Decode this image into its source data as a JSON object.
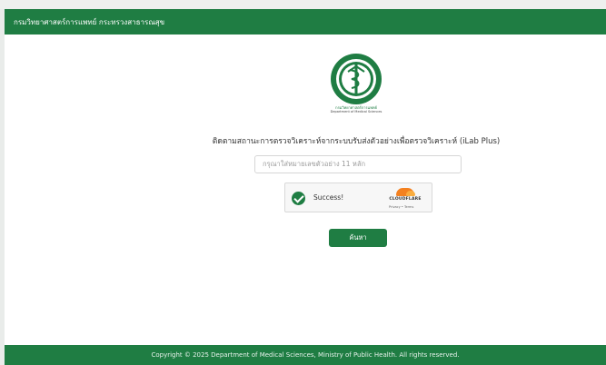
{
  "header": {
    "title": "กรมวิทยาศาสตร์การแพทย์ กระทรวงสาธารณสุข"
  },
  "logo": {
    "icon": "department-seal",
    "caption_thai": "กรมวิทยาศาสตร์การแพทย์",
    "caption_en": "Department of Medical Sciences"
  },
  "main": {
    "title": "ติดตามสถานะการตรวจวิเคราะห์จากระบบรับส่งตัวอย่างเพื่อตรวจวิเคราะห์ (iLab Plus)",
    "search_input": {
      "placeholder": "กรุณาใส่หมายเลขตัวอย่าง 11 หลัก",
      "value": ""
    },
    "captcha": {
      "status_text": "Success!",
      "provider": "CLOUDFLARE",
      "links": "Privacy • Terms"
    },
    "search_button": "ค้นหา"
  },
  "footer": {
    "copyright": "Copyright © 2025 Department of Medical Sciences, Ministry of Public Health. All rights reserved."
  },
  "colors": {
    "primary": "#1f7d43",
    "background": "#ffffff"
  }
}
